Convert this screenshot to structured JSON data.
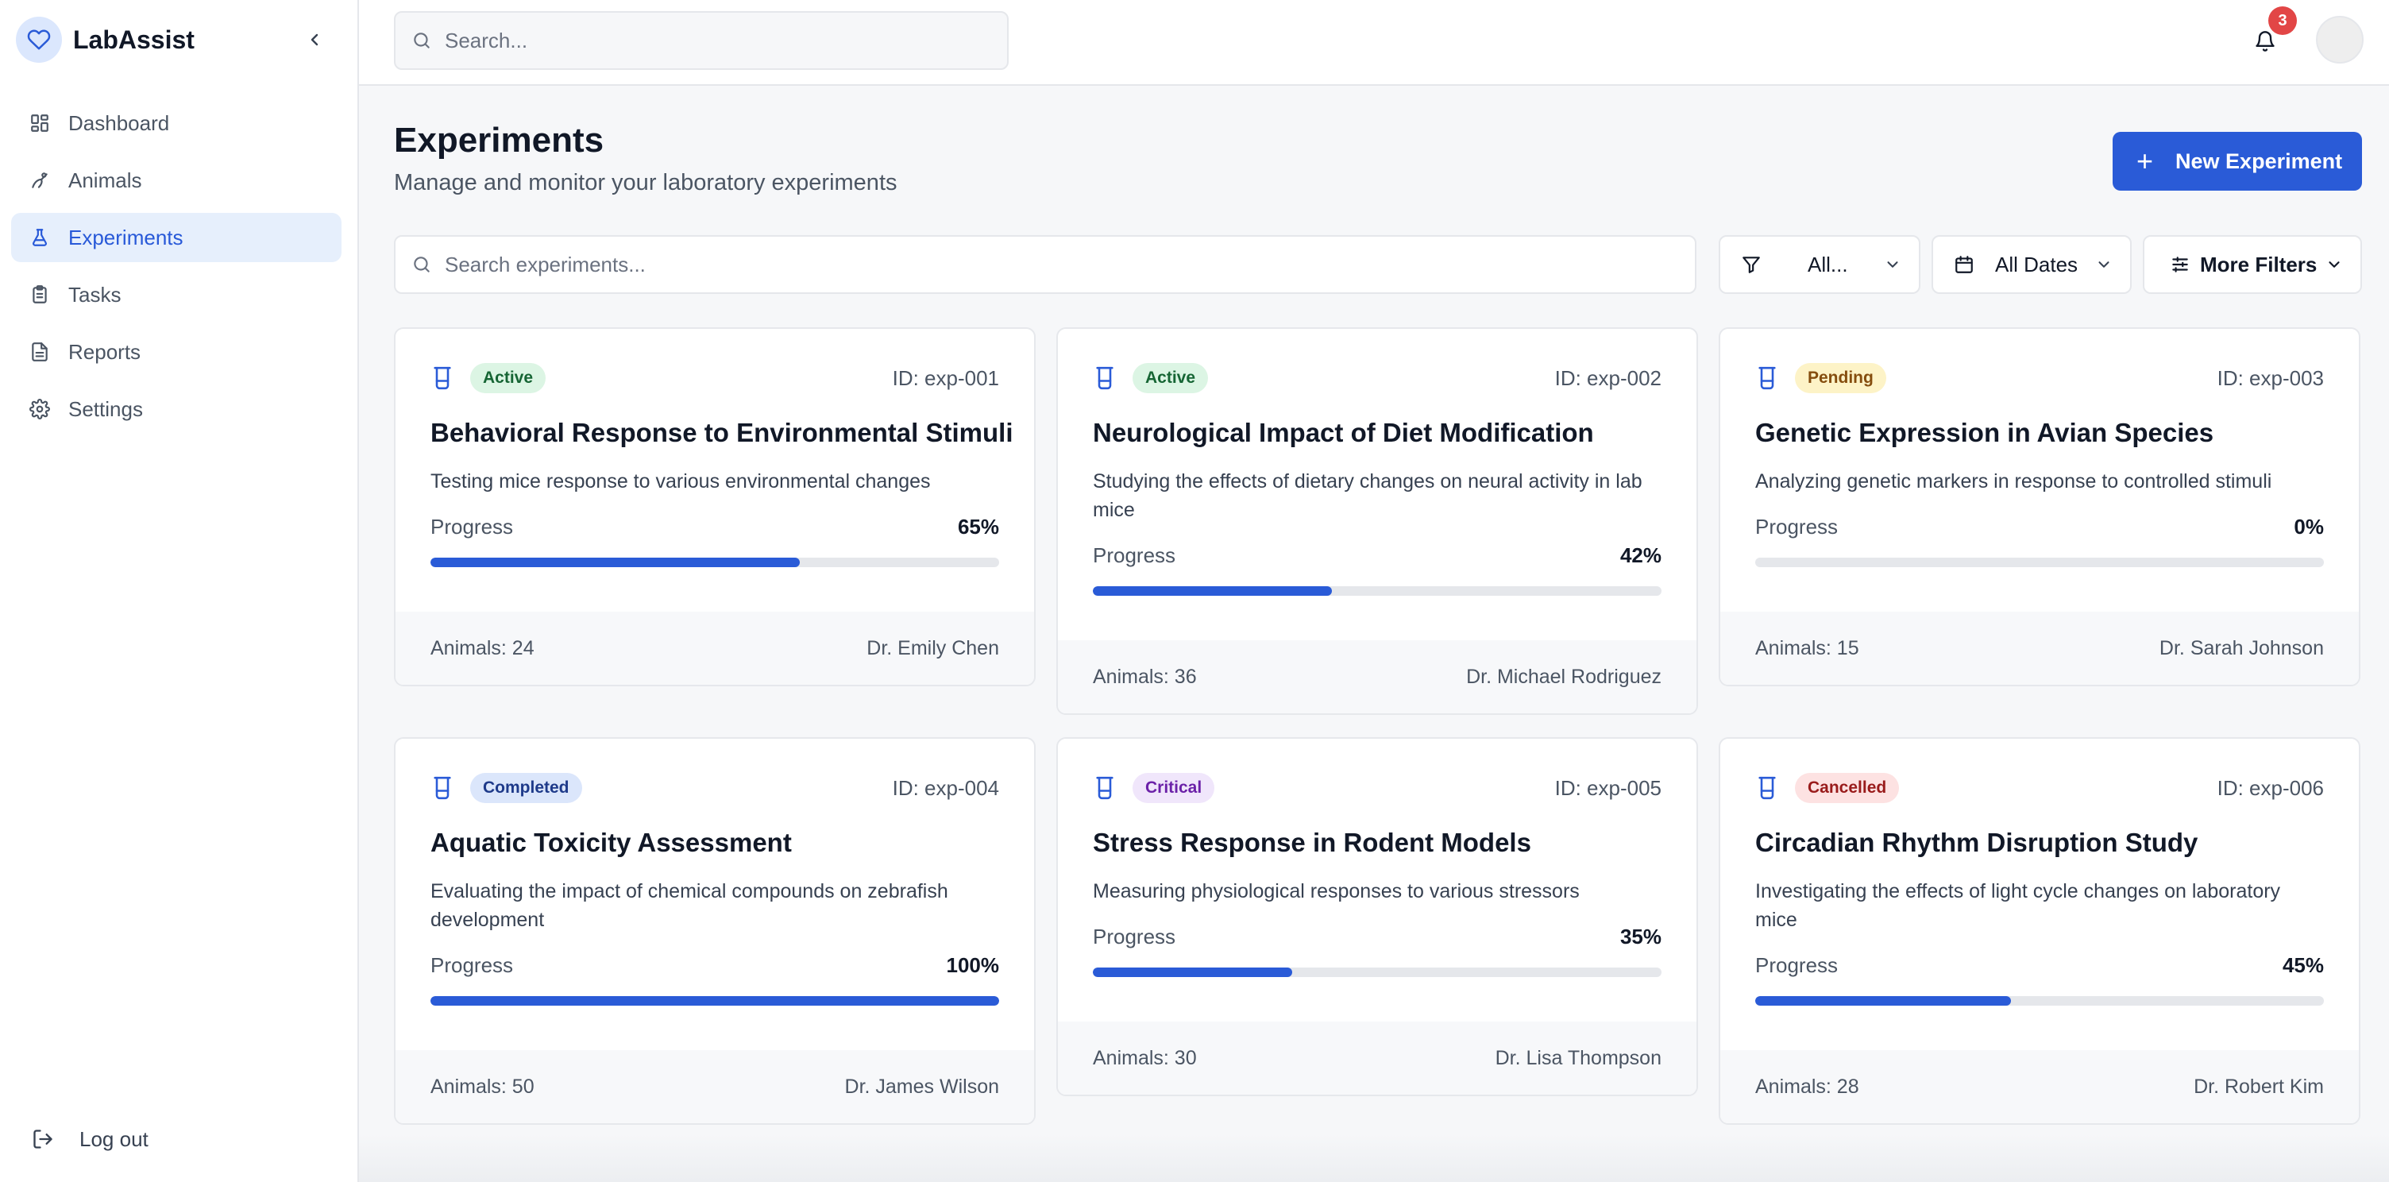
{
  "app": {
    "name": "LabAssist"
  },
  "sidebar": {
    "items": [
      {
        "label": "Dashboard",
        "icon": "dashboard-icon",
        "active": false
      },
      {
        "label": "Animals",
        "icon": "paw-icon",
        "active": false
      },
      {
        "label": "Experiments",
        "icon": "flask-icon",
        "active": true
      },
      {
        "label": "Tasks",
        "icon": "clipboard-icon",
        "active": false
      },
      {
        "label": "Reports",
        "icon": "file-icon",
        "active": false
      },
      {
        "label": "Settings",
        "icon": "gear-icon",
        "active": false
      }
    ],
    "logout_label": "Log out"
  },
  "topbar": {
    "search_placeholder": "Search...",
    "notification_count": "3"
  },
  "header": {
    "title": "Experiments",
    "subtitle": "Manage and monitor your laboratory experiments",
    "new_button_label": "New Experiment"
  },
  "filters": {
    "search_placeholder": "Search experiments...",
    "status_label": "All...",
    "date_label": "All Dates",
    "more_label": "More Filters"
  },
  "colors": {
    "accent": "#2a5bd7",
    "active_nav_bg": "#e6effc",
    "badge_active": "#dcf5e4",
    "badge_pending": "#fdf3c7",
    "badge_completed": "#dbe6fb",
    "badge_critical": "#f0e6fb",
    "badge_cancelled": "#fde2e2",
    "notification": "#e24646"
  },
  "progress_label": "Progress",
  "experiments": [
    {
      "status": "Active",
      "status_class": "active",
      "id": "ID: exp-001",
      "title": "Behavioral Response to Environmental Stimuli",
      "description": "Testing mice response to various environmental changes",
      "progress": 65,
      "progress_text": "65%",
      "animals": "Animals: 24",
      "researcher": "Dr. Emily Chen"
    },
    {
      "status": "Active",
      "status_class": "active",
      "id": "ID: exp-002",
      "title": "Neurological Impact of Diet Modification",
      "description": "Studying the effects of dietary changes on neural activity in lab mice",
      "progress": 42,
      "progress_text": "42%",
      "animals": "Animals: 36",
      "researcher": "Dr. Michael Rodriguez"
    },
    {
      "status": "Pending",
      "status_class": "pending",
      "id": "ID: exp-003",
      "title": "Genetic Expression in Avian Species",
      "description": "Analyzing genetic markers in response to controlled stimuli",
      "progress": 0,
      "progress_text": "0%",
      "animals": "Animals: 15",
      "researcher": "Dr. Sarah Johnson"
    },
    {
      "status": "Completed",
      "status_class": "completed",
      "id": "ID: exp-004",
      "title": "Aquatic Toxicity Assessment",
      "description": "Evaluating the impact of chemical compounds on zebrafish development",
      "progress": 100,
      "progress_text": "100%",
      "animals": "Animals: 50",
      "researcher": "Dr. James Wilson"
    },
    {
      "status": "Critical",
      "status_class": "critical",
      "id": "ID: exp-005",
      "title": "Stress Response in Rodent Models",
      "description": "Measuring physiological responses to various stressors",
      "progress": 35,
      "progress_text": "35%",
      "animals": "Animals: 30",
      "researcher": "Dr. Lisa Thompson"
    },
    {
      "status": "Cancelled",
      "status_class": "cancelled",
      "id": "ID: exp-006",
      "title": "Circadian Rhythm Disruption Study",
      "description": "Investigating the effects of light cycle changes on laboratory mice",
      "progress": 45,
      "progress_text": "45%",
      "animals": "Animals: 28",
      "researcher": "Dr. Robert Kim"
    }
  ]
}
